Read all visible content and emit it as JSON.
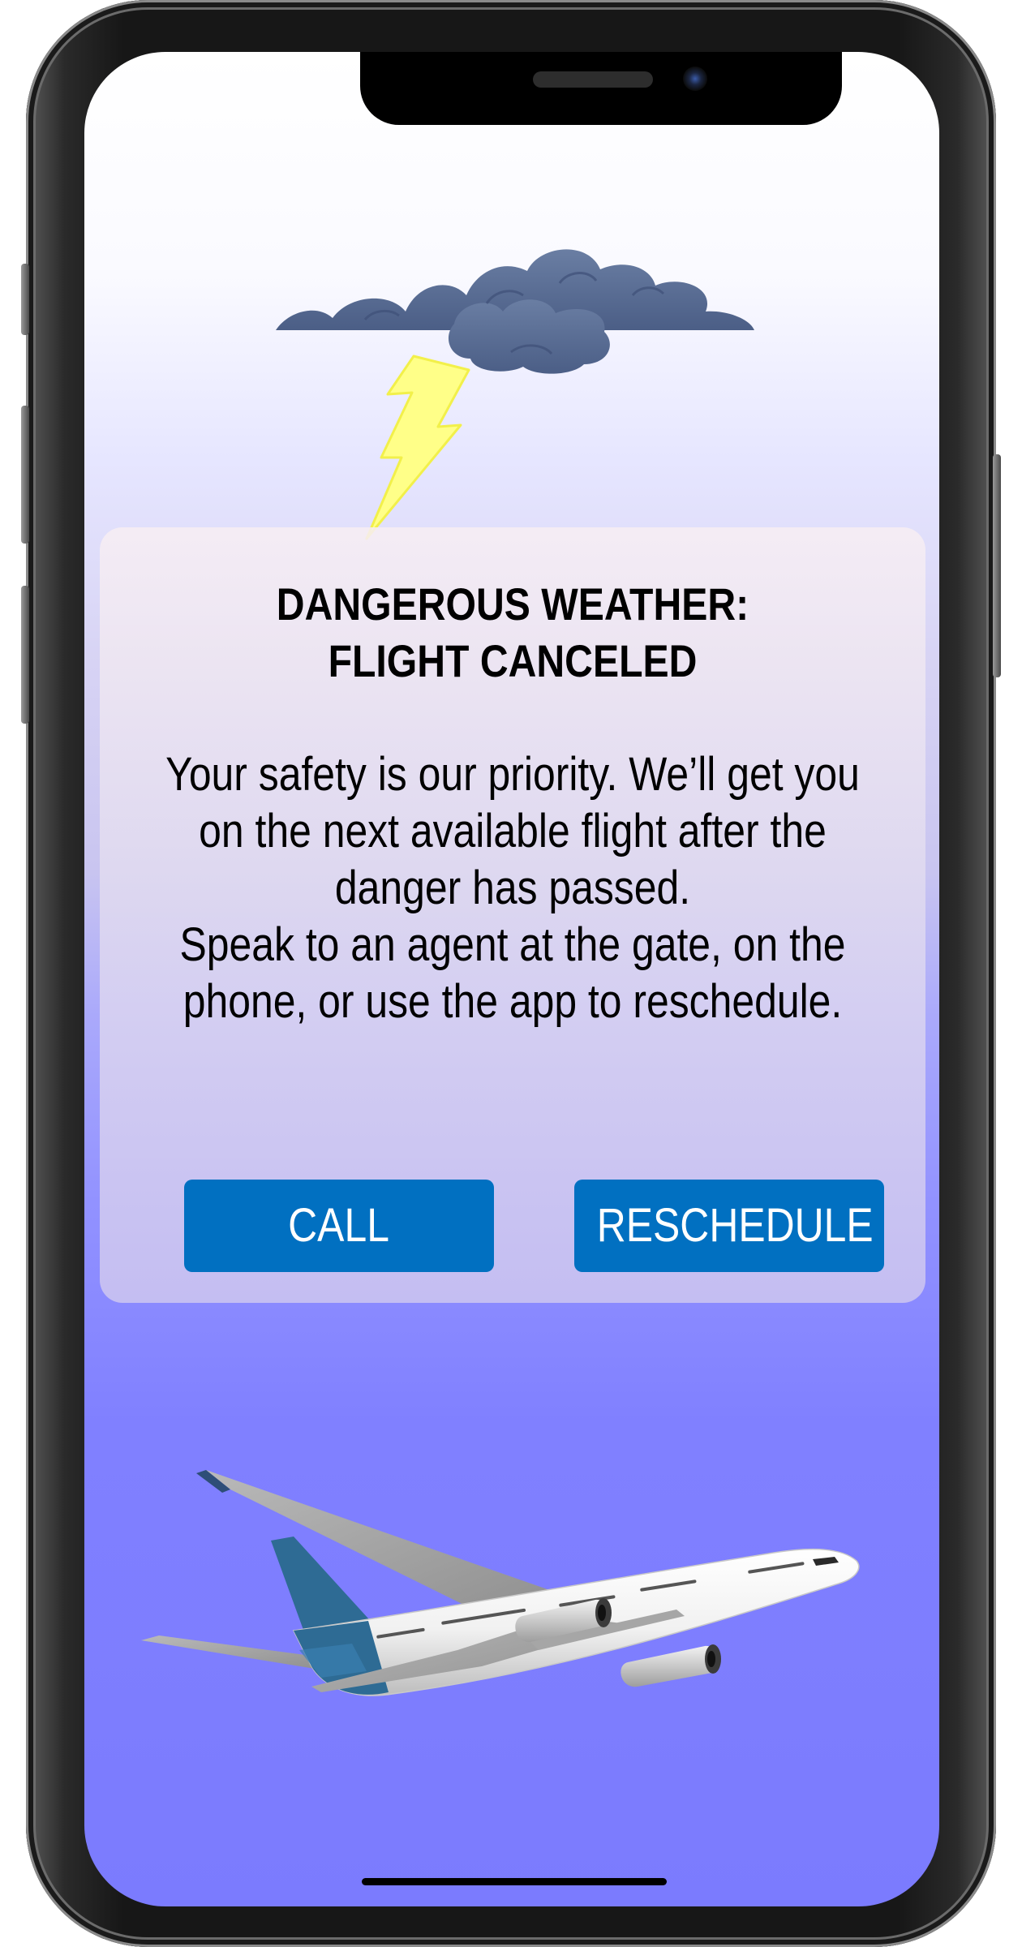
{
  "colors": {
    "accent": "#0170c1",
    "button_text": "#ffffff",
    "screen_top": "#ffffff",
    "screen_bottom": "#7b7bfe",
    "cloud": "#56698f",
    "lightning": "#ffff88",
    "airplane_tail": "#2e6b94"
  },
  "alert": {
    "title_line_1": "DANGEROUS WEATHER:",
    "title_line_2": "FLIGHT CANCELED",
    "message_line_1": "Your safety is our priority. We’ll get you",
    "message_line_2": "on the next available flight after the",
    "message_line_3": "danger has passed.",
    "message_line_4": "Speak to an agent at the gate, on the",
    "message_line_5": "phone, or use the app to reschedule."
  },
  "actions": {
    "call_label": "CALL",
    "reschedule_label": "RESCHEDULE"
  },
  "illustrations": {
    "top": "storm-cloud-lightning",
    "bottom": "airplane"
  }
}
